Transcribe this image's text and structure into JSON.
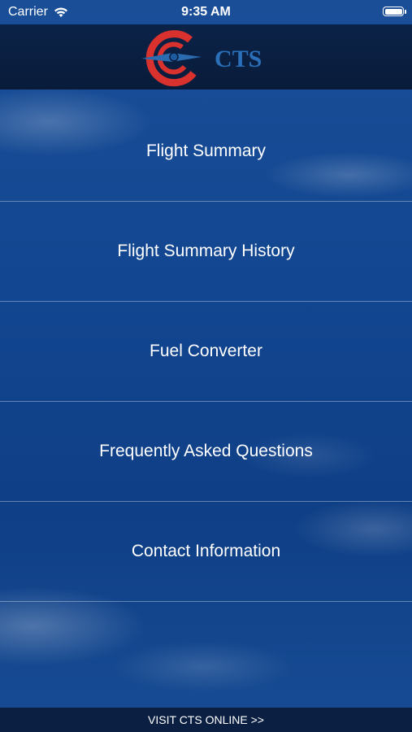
{
  "status_bar": {
    "carrier": "Carrier",
    "time": "9:35 AM",
    "wifi_icon": "wifi-icon",
    "battery_icon": "battery-icon"
  },
  "header": {
    "logo_text": "CTS",
    "logo_colors": {
      "red": "#d9322e",
      "blue": "#2b6cb0",
      "text": "#2a6fb8"
    }
  },
  "menu": {
    "items": [
      {
        "label": "Flight Summary"
      },
      {
        "label": "Flight Summary History"
      },
      {
        "label": "Fuel Converter"
      },
      {
        "label": "Frequently Asked Questions"
      },
      {
        "label": "Contact Information"
      }
    ]
  },
  "footer": {
    "link_label": "VISIT CTS ONLINE >>"
  }
}
